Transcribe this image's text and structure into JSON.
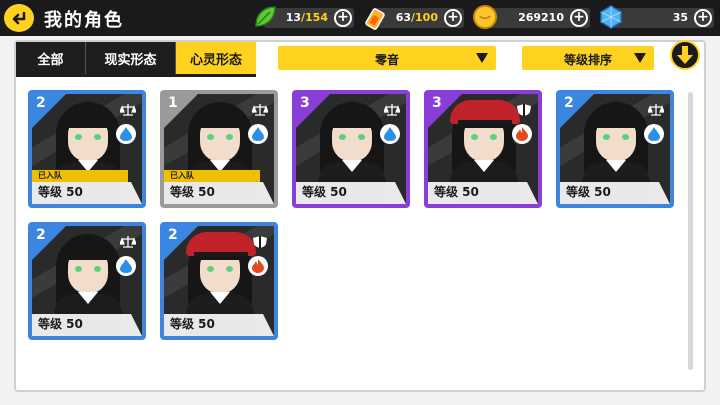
{
  "header": {
    "title": "我的角色",
    "back_icon": "back-arrow-icon"
  },
  "resources": [
    {
      "id": "stamina",
      "icon": "leaf-icon",
      "value": "13",
      "max": "/154"
    },
    {
      "id": "energy",
      "icon": "battery-icon",
      "value": "63",
      "max": "/100"
    },
    {
      "id": "coins",
      "icon": "coin-icon",
      "value": "269210",
      "max": ""
    },
    {
      "id": "gems",
      "icon": "crystal-icon",
      "value": "35",
      "max": ""
    }
  ],
  "tabs": [
    {
      "label": "全部",
      "active": false
    },
    {
      "label": "现实形态",
      "active": false
    },
    {
      "label": "心灵形态",
      "active": true
    }
  ],
  "filters": {
    "character_filter": "零音",
    "sort_by": "等级排序",
    "sort_direction_icon": "arrow-down-icon"
  },
  "colors": {
    "accent": "#ffd21f",
    "rank_blue": "#3b86e0",
    "rank_purple": "#8a3ed8",
    "rank_grey": "#9a9a9a",
    "water": "#2e8fe8",
    "fire": "#e24a22"
  },
  "cards": [
    {
      "rank": "2",
      "frame": "blue",
      "level": "等级 50",
      "team": "已入队",
      "element": "water",
      "class": "balance-icon",
      "style": "maid"
    },
    {
      "rank": "1",
      "frame": "grey",
      "level": "等级 50",
      "team": "已入队",
      "element": "water",
      "class": "balance-icon",
      "style": "plain"
    },
    {
      "rank": "3",
      "frame": "purple",
      "level": "等级 50",
      "team": "",
      "element": "water",
      "class": "balance-icon",
      "style": "star"
    },
    {
      "rank": "3",
      "frame": "purple",
      "level": "等级 50",
      "team": "",
      "element": "fire",
      "class": "shield-icon",
      "style": "hat"
    },
    {
      "rank": "2",
      "frame": "blue",
      "level": "等级 50",
      "team": "",
      "element": "water",
      "class": "balance-icon",
      "style": "plain"
    },
    {
      "rank": "2",
      "frame": "blue",
      "level": "等级 50",
      "team": "",
      "element": "water",
      "class": "balance-icon",
      "style": "plain"
    },
    {
      "rank": "2",
      "frame": "blue",
      "level": "等级 50",
      "team": "",
      "element": "fire",
      "class": "shield-icon",
      "style": "hat"
    }
  ]
}
